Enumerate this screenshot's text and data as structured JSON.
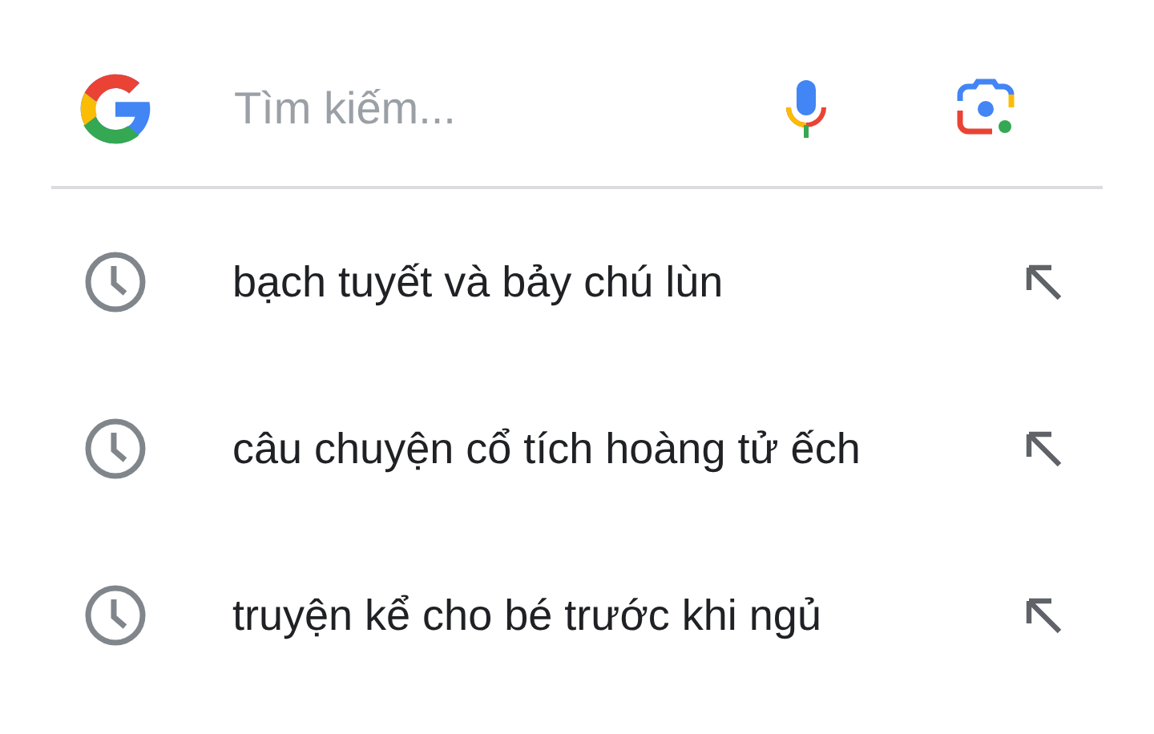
{
  "search": {
    "placeholder": "Tìm kiếm..."
  },
  "suggestions": [
    {
      "text": "bạch tuyết và bảy chú lùn"
    },
    {
      "text": "câu chuyện cổ tích hoàng tử ếch"
    },
    {
      "text": "truyện kể cho bé trước khi ngủ"
    }
  ]
}
